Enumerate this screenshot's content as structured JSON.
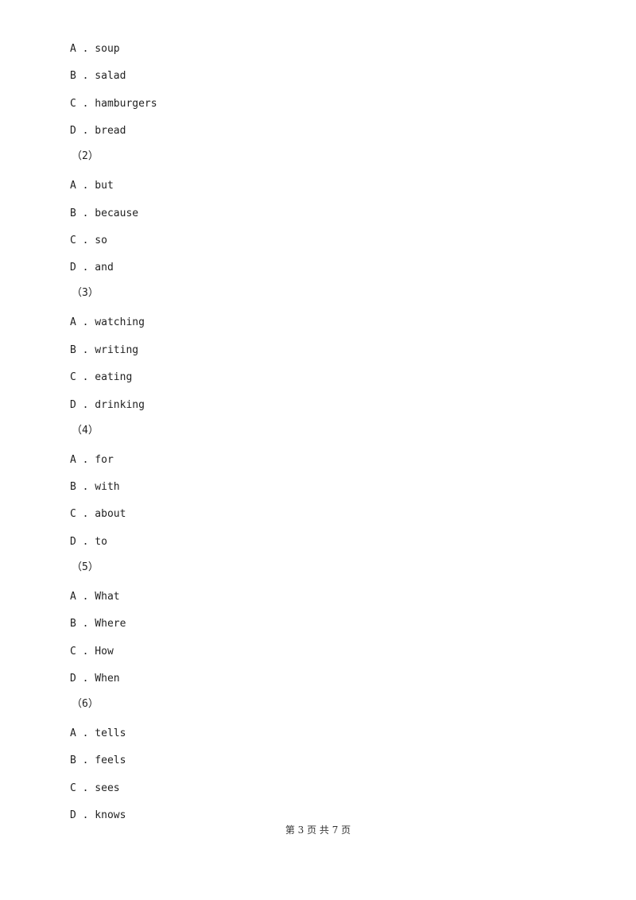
{
  "blocks": [
    {
      "type": "option",
      "text": "A . soup"
    },
    {
      "type": "option",
      "text": "B . salad"
    },
    {
      "type": "option",
      "text": "C . hamburgers"
    },
    {
      "type": "option",
      "text": "D . bread"
    },
    {
      "type": "question",
      "text": "（2）"
    },
    {
      "type": "option",
      "text": "A . but"
    },
    {
      "type": "option",
      "text": "B . because"
    },
    {
      "type": "option",
      "text": "C . so"
    },
    {
      "type": "option",
      "text": "D . and"
    },
    {
      "type": "question",
      "text": "（3）"
    },
    {
      "type": "option",
      "text": "A . watching"
    },
    {
      "type": "option",
      "text": "B . writing"
    },
    {
      "type": "option",
      "text": "C . eating"
    },
    {
      "type": "option",
      "text": "D . drinking"
    },
    {
      "type": "question",
      "text": "（4）"
    },
    {
      "type": "option",
      "text": "A . for"
    },
    {
      "type": "option",
      "text": "B . with"
    },
    {
      "type": "option",
      "text": "C . about"
    },
    {
      "type": "option",
      "text": "D . to"
    },
    {
      "type": "question",
      "text": "（5）"
    },
    {
      "type": "option",
      "text": "A . What"
    },
    {
      "type": "option",
      "text": "B . Where"
    },
    {
      "type": "option",
      "text": "C . How"
    },
    {
      "type": "option",
      "text": "D . When"
    },
    {
      "type": "question",
      "text": "（6）"
    },
    {
      "type": "option",
      "text": "A . tells"
    },
    {
      "type": "option",
      "text": "B . feels"
    },
    {
      "type": "option",
      "text": "C . sees"
    },
    {
      "type": "option",
      "text": "D . knows"
    }
  ],
  "footer": "第 3 页 共 7 页"
}
